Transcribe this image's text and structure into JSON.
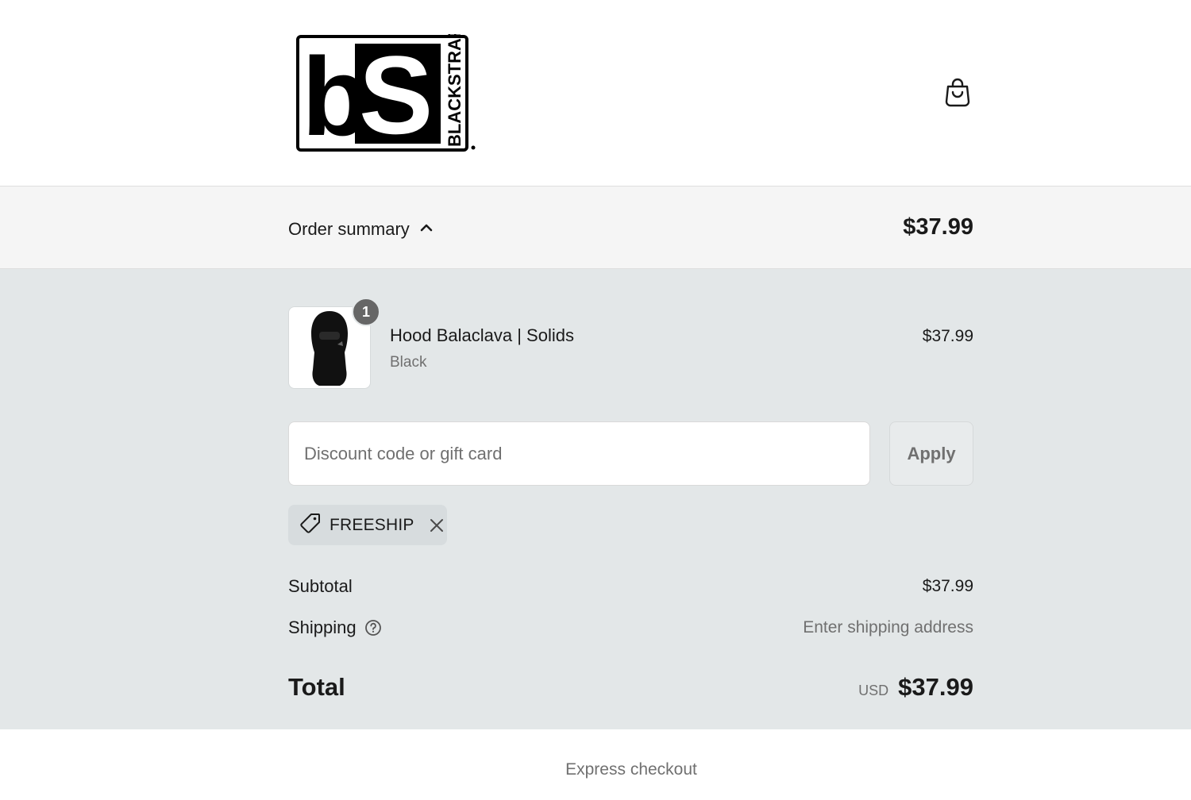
{
  "header": {
    "logo_text": "BLACKSTRAP",
    "logo_monogram": "bS",
    "cart_icon": "shopping-bag-icon"
  },
  "order_summary": {
    "toggle_label": "Order summary",
    "toggle_icon": "chevron-up-icon",
    "total": "$37.99"
  },
  "line_items": [
    {
      "name": "Hood Balaclava | Solids",
      "variant": "Black",
      "price": "$37.99",
      "quantity": "1"
    }
  ],
  "discount": {
    "placeholder": "Discount code or gift card",
    "value": "",
    "apply_label": "Apply",
    "applied_code": "FREESHIP"
  },
  "totals": {
    "subtotal_label": "Subtotal",
    "subtotal_value": "$37.99",
    "shipping_label": "Shipping",
    "shipping_value": "Enter shipping address",
    "total_label": "Total",
    "currency": "USD",
    "total_value": "$37.99"
  },
  "express_checkout": {
    "label": "Express checkout"
  },
  "colors": {
    "summary_bg": "#e3e7e8",
    "toggle_bg": "#f5f5f5",
    "muted_text": "#707070",
    "badge": "#666666"
  }
}
